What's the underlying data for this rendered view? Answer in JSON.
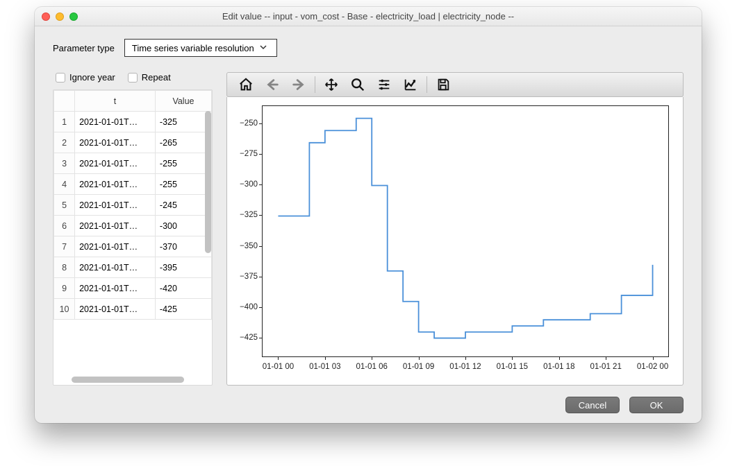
{
  "window": {
    "title": "Edit value    -- input - vom_cost - Base - electricity_load | electricity_node --"
  },
  "param": {
    "label": "Parameter type",
    "value": "Time series variable resolution"
  },
  "checks": {
    "ignore_year": "Ignore year",
    "repeat": "Repeat"
  },
  "table": {
    "headers": {
      "t": "t",
      "value": "Value"
    },
    "rows": [
      {
        "idx": "1",
        "t": "2021-01-01T…",
        "v": "-325"
      },
      {
        "idx": "2",
        "t": "2021-01-01T…",
        "v": "-265"
      },
      {
        "idx": "3",
        "t": "2021-01-01T…",
        "v": "-255"
      },
      {
        "idx": "4",
        "t": "2021-01-01T…",
        "v": "-255"
      },
      {
        "idx": "5",
        "t": "2021-01-01T…",
        "v": "-245"
      },
      {
        "idx": "6",
        "t": "2021-01-01T…",
        "v": "-300"
      },
      {
        "idx": "7",
        "t": "2021-01-01T…",
        "v": "-370"
      },
      {
        "idx": "8",
        "t": "2021-01-01T…",
        "v": "-395"
      },
      {
        "idx": "9",
        "t": "2021-01-01T…",
        "v": "-420"
      },
      {
        "idx": "10",
        "t": "2021-01-01T…",
        "v": "-425"
      }
    ]
  },
  "chart_data": {
    "type": "line",
    "series_style": "step",
    "x_hours": [
      0,
      1,
      2,
      3,
      4,
      5,
      6,
      7,
      8,
      9,
      10,
      11,
      12,
      13,
      14,
      15,
      16,
      17,
      18,
      19,
      20,
      21,
      22,
      23,
      24
    ],
    "values": [
      -325,
      -325,
      -265,
      -255,
      -255,
      -245,
      -300,
      -370,
      -395,
      -420,
      -425,
      -425,
      -420,
      -420,
      -420,
      -415,
      -415,
      -410,
      -410,
      -410,
      -405,
      -405,
      -390,
      -390,
      -365
    ],
    "ylim": [
      -440,
      -235
    ],
    "yticks": [
      -250,
      -275,
      -300,
      -325,
      -350,
      -375,
      -400,
      -425
    ],
    "xlim_hours": [
      -1,
      25
    ],
    "xticks": [
      {
        "h": 0,
        "label": "01-01 00"
      },
      {
        "h": 3,
        "label": "01-01 03"
      },
      {
        "h": 6,
        "label": "01-01 06"
      },
      {
        "h": 9,
        "label": "01-01 09"
      },
      {
        "h": 12,
        "label": "01-01 12"
      },
      {
        "h": 15,
        "label": "01-01 15"
      },
      {
        "h": 18,
        "label": "01-01 18"
      },
      {
        "h": 21,
        "label": "01-01 21"
      },
      {
        "h": 24,
        "label": "01-02 00"
      }
    ]
  },
  "buttons": {
    "cancel": "Cancel",
    "ok": "OK"
  }
}
